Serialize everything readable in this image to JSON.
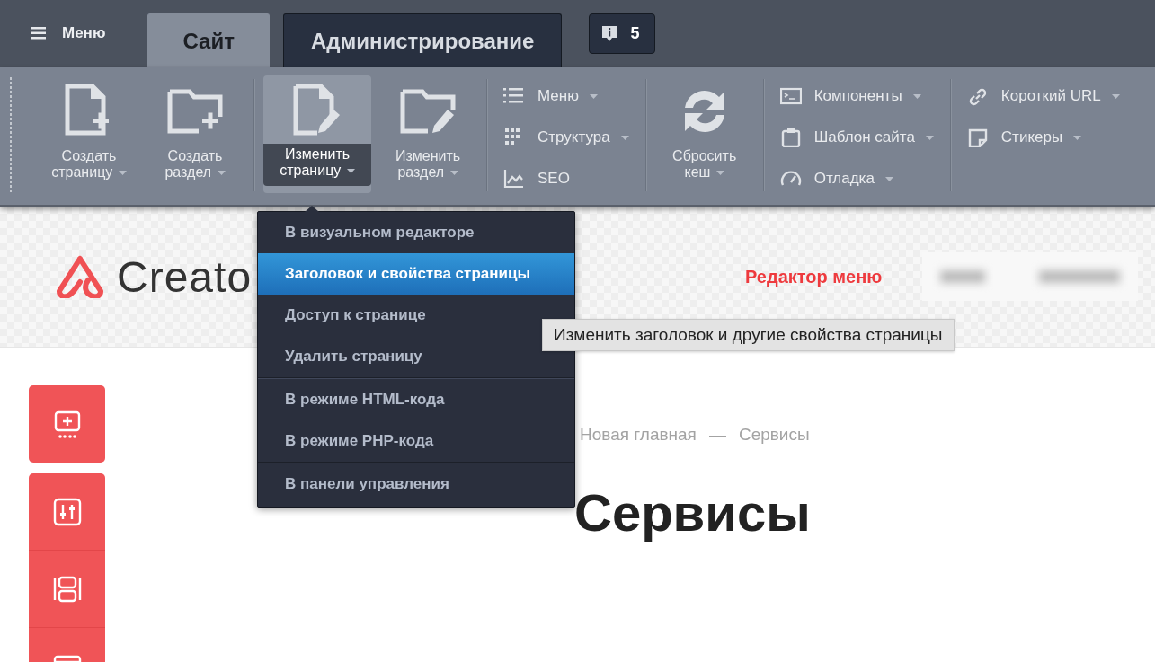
{
  "top_bar": {
    "menu_button": "Меню",
    "tabs": [
      {
        "label": "Сайт",
        "selected": true
      },
      {
        "label": "Администрирование",
        "selected": false
      }
    ],
    "notifications": "5"
  },
  "toolbar": {
    "groups": [
      {
        "kind": "large",
        "items": [
          {
            "label": "Создать страницу",
            "kind": "newpage",
            "selected": false
          },
          {
            "label": "Создать раздел",
            "kind": "newfolder",
            "selected": false
          }
        ]
      },
      {
        "kind": "large",
        "items": [
          {
            "label": "Изменить страницу",
            "kind": "editpage",
            "selected": true
          },
          {
            "label": "Изменить раздел",
            "kind": "editfolder",
            "selected": false
          }
        ]
      },
      {
        "kind": "small",
        "items": [
          {
            "label": "Меню",
            "kind": "list",
            "has_menu": true
          },
          {
            "label": "Структура",
            "kind": "grid",
            "has_menu": true
          },
          {
            "label": "SEO",
            "kind": "chart",
            "has_menu": false
          }
        ]
      },
      {
        "kind": "large",
        "items": [
          {
            "label": "Сбросить кеш",
            "kind": "refresh",
            "selected": false
          }
        ]
      },
      {
        "kind": "small",
        "items": [
          {
            "label": "Компоненты",
            "kind": "terminal",
            "has_menu": true
          },
          {
            "label": "Шаблон сайта",
            "kind": "clipboard",
            "has_menu": true
          },
          {
            "label": "Отладка",
            "kind": "gauge",
            "has_menu": true
          }
        ]
      },
      {
        "kind": "small",
        "items": [
          {
            "label": "Короткий URL",
            "kind": "link",
            "has_menu": true
          },
          {
            "label": "Стикеры",
            "kind": "note",
            "has_menu": true
          }
        ]
      }
    ]
  },
  "dropdown": {
    "sections": [
      {
        "items": [
          {
            "label": "В визуальном редакторе",
            "selected": false
          },
          {
            "label": "Заголовок и свойства страницы",
            "selected": true
          },
          {
            "label": "Доступ к странице",
            "selected": false
          },
          {
            "label": "Удалить страницу",
            "selected": false
          }
        ]
      },
      {
        "items": [
          {
            "label": "В режиме HTML-кода",
            "selected": false
          },
          {
            "label": "В режиме PHP-кода",
            "selected": false
          }
        ]
      },
      {
        "items": [
          {
            "label": "В панели управления",
            "selected": false
          }
        ]
      }
    ]
  },
  "tooltip": "Изменить заголовок и другие свойства страницы",
  "site": {
    "logo": "Creato",
    "nav_link": "Редактор меню",
    "side_buttons": [
      {
        "kind": "comment"
      },
      {
        "kind": "sliders"
      },
      {
        "kind": "layout"
      },
      {
        "kind": "card"
      }
    ],
    "breadcrumbs": [
      "Новая главная",
      "Сервисы"
    ],
    "breadcrumb_separator": "—",
    "title": "Сервисы"
  }
}
